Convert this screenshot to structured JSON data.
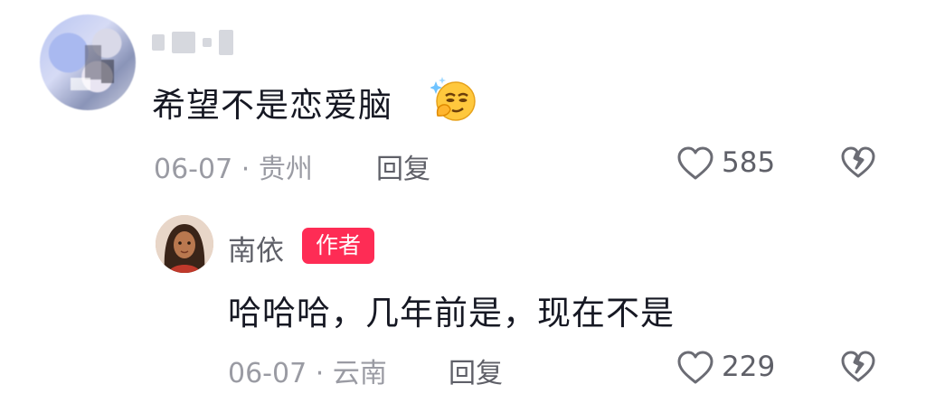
{
  "comment": {
    "text": "希望不是恋爱脑",
    "emoji": "thinking-face-with-sparkle-emoji",
    "date": "06-07",
    "separator": "·",
    "location": "贵州",
    "reply_label": "回复",
    "like_count": "585"
  },
  "reply": {
    "author_name": "南依",
    "author_badge": "作者",
    "text": "哈哈哈，几年前是，现在不是",
    "date": "06-07",
    "separator": "·",
    "location": "云南",
    "reply_label": "回复",
    "like_count": "229"
  },
  "colors": {
    "badge": "#fe2c55",
    "meta": "#9a9ba3",
    "primary_text": "#161823"
  }
}
